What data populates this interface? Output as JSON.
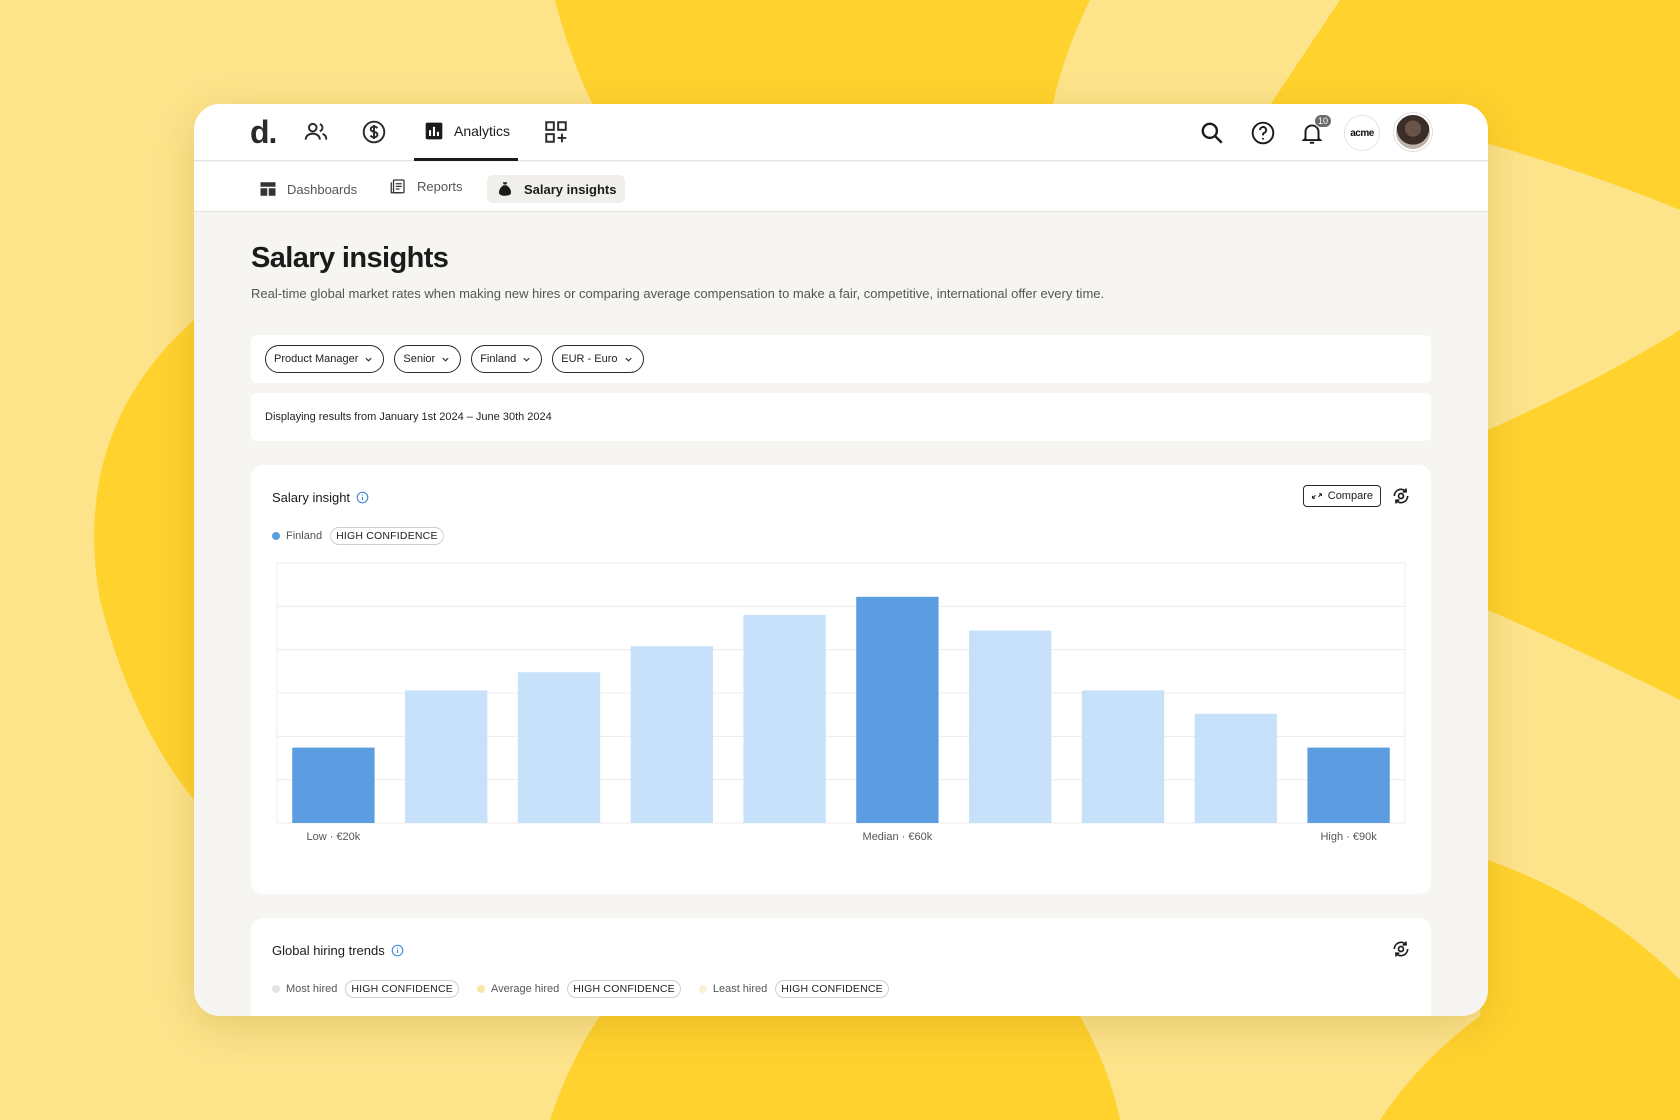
{
  "app": {
    "logo": "d.",
    "nav": {
      "analytics_label": "Analytics",
      "notifications_count": "10",
      "org_logo_text": "acme"
    },
    "subnav": {
      "tabs": [
        {
          "label": "Dashboards"
        },
        {
          "label": "Reports"
        },
        {
          "label": "Salary insights"
        }
      ]
    }
  },
  "page": {
    "title": "Salary insights",
    "description": "Real-time global market rates when making new hires or comparing average compensation to make a fair, competitive, international offer every time.",
    "filters": [
      "Product Manager",
      "Senior",
      "Finland",
      "EUR - Euro"
    ],
    "date_range": "Displaying results from January 1st 2024 – June 30th 2024"
  },
  "salary_card": {
    "title": "Salary insight",
    "compare_label": "Compare",
    "legend": {
      "name": "Finland",
      "confidence": "HIGH CONFIDENCE",
      "color": "#5b9de0"
    }
  },
  "chart_data": {
    "type": "bar",
    "values": [
      29,
      51,
      58,
      68,
      80,
      87,
      74,
      51,
      42,
      29
    ],
    "highlight": [
      true,
      false,
      false,
      false,
      false,
      true,
      false,
      false,
      false,
      true
    ],
    "colors": {
      "highlight": "#5b9de0",
      "normal": "#c8e1fa",
      "grid": "#ececec"
    },
    "ylim": [
      0,
      100
    ],
    "x_labels": [
      {
        "index": 0,
        "text": "Low · €20k"
      },
      {
        "index": 5,
        "text": "Median · €60k"
      },
      {
        "index": 9,
        "text": "High · €90k"
      }
    ],
    "grid": true
  },
  "trends_card": {
    "title": "Global hiring trends",
    "legend": [
      {
        "name": "Most hired",
        "confidence": "HIGH CONFIDENCE",
        "color": "#e3e3e3"
      },
      {
        "name": "Average hired",
        "confidence": "HIGH CONFIDENCE",
        "color": "#f8e6a6"
      },
      {
        "name": "Least hired",
        "confidence": "HIGH CONFIDENCE",
        "color": "#faf0d2"
      }
    ]
  }
}
